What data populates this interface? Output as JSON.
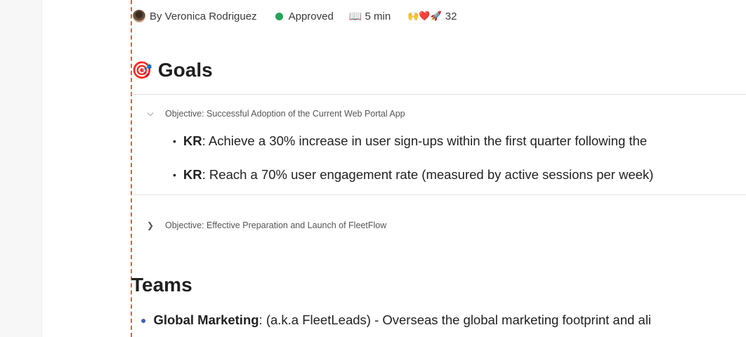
{
  "meta": {
    "author": "By Veronica Rodriguez",
    "status": "Approved",
    "status_color": "#27a35a",
    "read_time": "5 min",
    "reactions_emoji": "🙌❤️🚀",
    "reactions_count": "32"
  },
  "goals": {
    "title": "Goals",
    "icon": "🎯",
    "objectives": [
      {
        "label": "Objective: Successful Adoption of the Current Web Portal App",
        "expanded": true,
        "key_results": [
          {
            "prefix": "KR",
            "text": ": Achieve a 30% increase in user sign-ups within the first quarter following the"
          },
          {
            "prefix": "KR",
            "text": ": Reach a 70% user engagement rate (measured by active sessions per week)"
          }
        ]
      },
      {
        "label": "Objective: Effective Preparation and Launch of FleetFlow",
        "expanded": false
      }
    ]
  },
  "teams": {
    "title": "Teams",
    "items": [
      {
        "name": "Global Marketing",
        "text": ": (a.k.a FleetLeads) - Overseas the global marketing footprint and ali"
      }
    ]
  },
  "accent_color": "#e8584a"
}
